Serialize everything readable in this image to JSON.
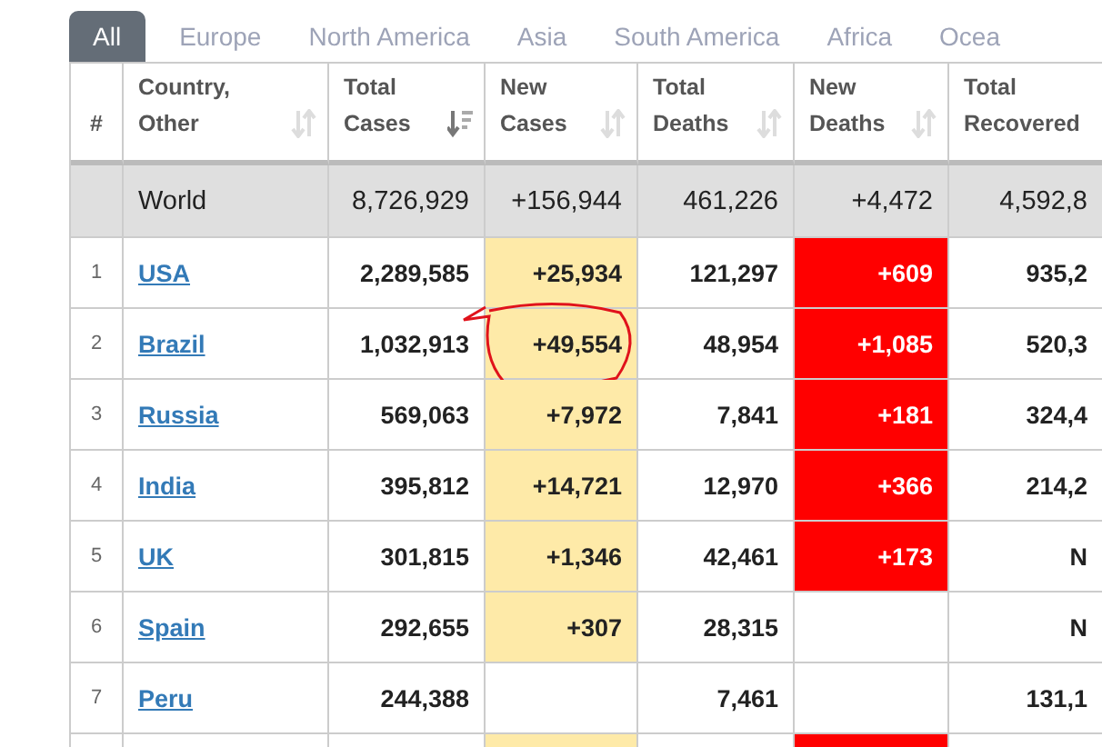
{
  "tabs": [
    {
      "label": "All",
      "selected": true
    },
    {
      "label": "Europe",
      "selected": false
    },
    {
      "label": "North America",
      "selected": false
    },
    {
      "label": "Asia",
      "selected": false
    },
    {
      "label": "South America",
      "selected": false
    },
    {
      "label": "Africa",
      "selected": false
    },
    {
      "label": "Ocea",
      "selected": false
    }
  ],
  "table": {
    "columns": [
      {
        "label": "#",
        "sortable": false
      },
      {
        "label": "Country,\nOther",
        "sortable": true,
        "sorted": false
      },
      {
        "label": "Total\nCases",
        "sortable": true,
        "sorted": true
      },
      {
        "label": "New\nCases",
        "sortable": true,
        "sorted": false
      },
      {
        "label": "Total\nDeaths",
        "sortable": true,
        "sorted": false
      },
      {
        "label": "New\nDeaths",
        "sortable": true,
        "sorted": false
      },
      {
        "label": "Total\nRecovered",
        "sortable": false
      }
    ],
    "world": {
      "country": "World",
      "total_cases": "8,726,929",
      "new_cases": "+156,944",
      "total_deaths": "461,226",
      "new_deaths": "+4,472",
      "total_recovered": "4,592,8"
    },
    "rows": [
      {
        "rank": "1",
        "country": "USA",
        "total_cases": "2,289,585",
        "new_cases": "+25,934",
        "total_deaths": "121,297",
        "new_deaths": "+609",
        "total_recovered": "935,2",
        "circled": false
      },
      {
        "rank": "2",
        "country": "Brazil",
        "total_cases": "1,032,913",
        "new_cases": "+49,554",
        "total_deaths": "48,954",
        "new_deaths": "+1,085",
        "total_recovered": "520,3",
        "circled": true
      },
      {
        "rank": "3",
        "country": "Russia",
        "total_cases": "569,063",
        "new_cases": "+7,972",
        "total_deaths": "7,841",
        "new_deaths": "+181",
        "total_recovered": "324,4",
        "circled": false
      },
      {
        "rank": "4",
        "country": "India",
        "total_cases": "395,812",
        "new_cases": "+14,721",
        "total_deaths": "12,970",
        "new_deaths": "+366",
        "total_recovered": "214,2",
        "circled": false
      },
      {
        "rank": "5",
        "country": "UK",
        "total_cases": "301,815",
        "new_cases": "+1,346",
        "total_deaths": "42,461",
        "new_deaths": "+173",
        "total_recovered": "N",
        "circled": false
      },
      {
        "rank": "6",
        "country": "Spain",
        "total_cases": "292,655",
        "new_cases": "+307",
        "total_deaths": "28,315",
        "total_recovered": "N",
        "circled": false
      },
      {
        "rank": "7",
        "country": "Peru",
        "total_cases": "244,388",
        "total_deaths": "7,461",
        "total_recovered": "131,1",
        "circled": false
      }
    ],
    "partial_row": {
      "new_cases_highlight": true,
      "new_deaths_highlight": true
    }
  }
}
